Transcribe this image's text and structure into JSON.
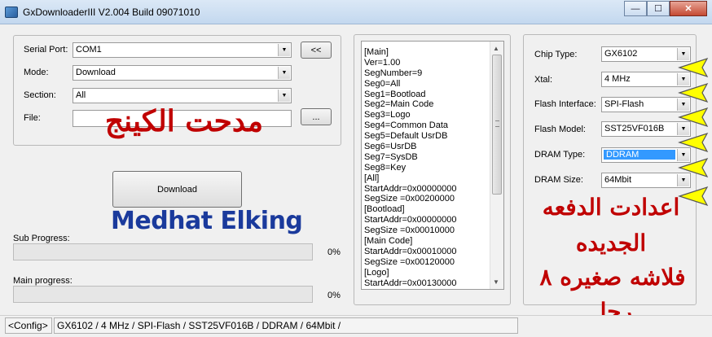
{
  "window": {
    "title": "GxDownloaderIII V2.004 Build 09071010",
    "minimize": "—",
    "maximize": "☐",
    "close": "✕"
  },
  "left": {
    "serial_port": {
      "label": "Serial Port:",
      "value": "COM1"
    },
    "mode": {
      "label": "Mode:",
      "value": "Download"
    },
    "section": {
      "label": "Section:",
      "value": "All"
    },
    "file": {
      "label": "File:",
      "value": ""
    },
    "swap_button": "<<",
    "browse_button": "...",
    "download_button": "Download",
    "sub_progress": {
      "label": "Sub Progress:",
      "percent_text": "0%",
      "value": 0
    },
    "main_progress": {
      "label": "Main progress:",
      "percent_text": "0%",
      "value": 0
    }
  },
  "config_list": [
    "[Main]",
    "Ver=1.00",
    "SegNumber=9",
    "Seg0=All",
    "Seg1=Bootload",
    "Seg2=Main Code",
    "Seg3=Logo",
    "Seg4=Common Data",
    "Seg5=Default UsrDB",
    "Seg6=UsrDB",
    "Seg7=SysDB",
    "Seg8=Key",
    "[All]",
    "StartAddr=0x00000000",
    "SegSize   =0x00200000",
    "[Bootload]",
    "StartAddr=0x00000000",
    "SegSize   =0x00010000",
    "[Main Code]",
    "StartAddr=0x00010000",
    "SegSize   =0x00120000",
    "[Logo]",
    "StartAddr=0x00130000"
  ],
  "right": {
    "chip_type": {
      "label": "Chip Type:",
      "value": "GX6102"
    },
    "xtal": {
      "label": "Xtal:",
      "value": "4 MHz"
    },
    "flash_interface": {
      "label": "Flash Interface:",
      "value": "SPI-Flash"
    },
    "flash_model": {
      "label": "Flash Model:",
      "value": "SST25VF016B"
    },
    "dram_type": {
      "label": "DRAM Type:",
      "value": "DDRAM"
    },
    "dram_size": {
      "label": "DRAM Size:",
      "value": "64Mbit"
    }
  },
  "status": {
    "config_tab": "<Config>",
    "summary": "GX6102 / 4 MHz / SPI-Flash / SST25VF016B / DDRAM / 64Mbit /"
  },
  "overlay": {
    "arabic_name": "مدحت الكينج",
    "english_name": "Medhat Elking",
    "note_line1": "اعدادت الدفعه",
    "note_line2": "الجديده",
    "note_line3": "فلاشه صغيره ٨",
    "note_line4": "رجل"
  },
  "colors": {
    "overlay_red": "#c00000",
    "overlay_blue": "#1a3a9c",
    "selection": "#3399ff",
    "marker_yellow": "#ffff00"
  }
}
